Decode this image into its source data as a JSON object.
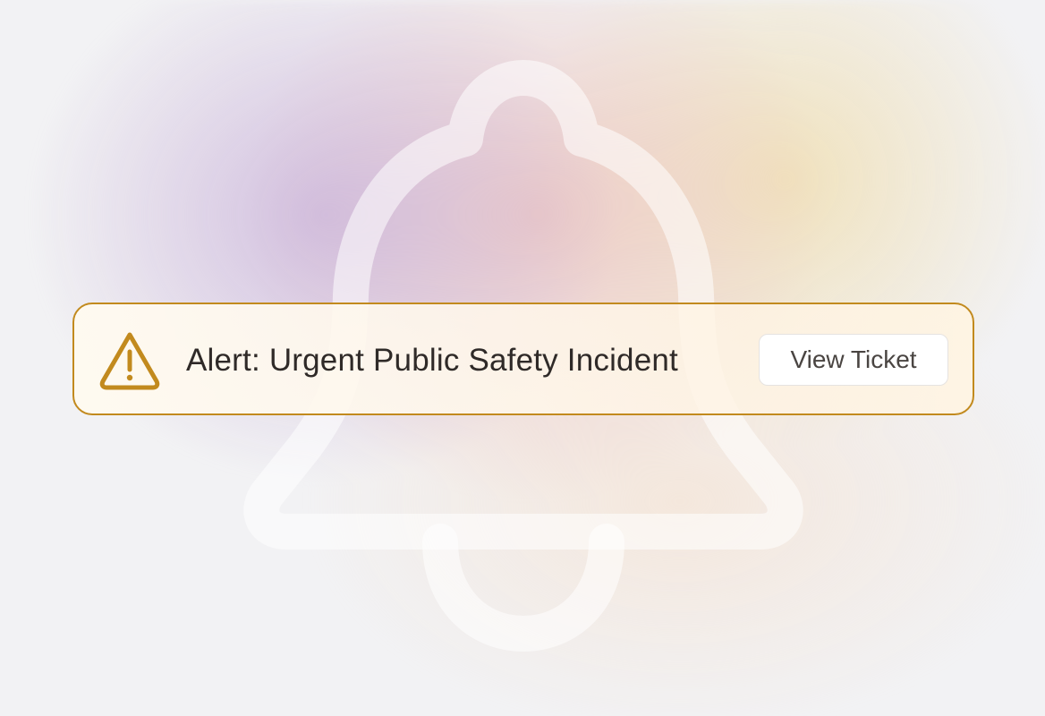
{
  "alert": {
    "message": "Alert: Urgent Public Safety Incident",
    "button_label": "View Ticket",
    "icon": "warning-triangle-icon",
    "accent_color": "#c28a1e"
  },
  "background": {
    "icon": "bell-icon"
  }
}
